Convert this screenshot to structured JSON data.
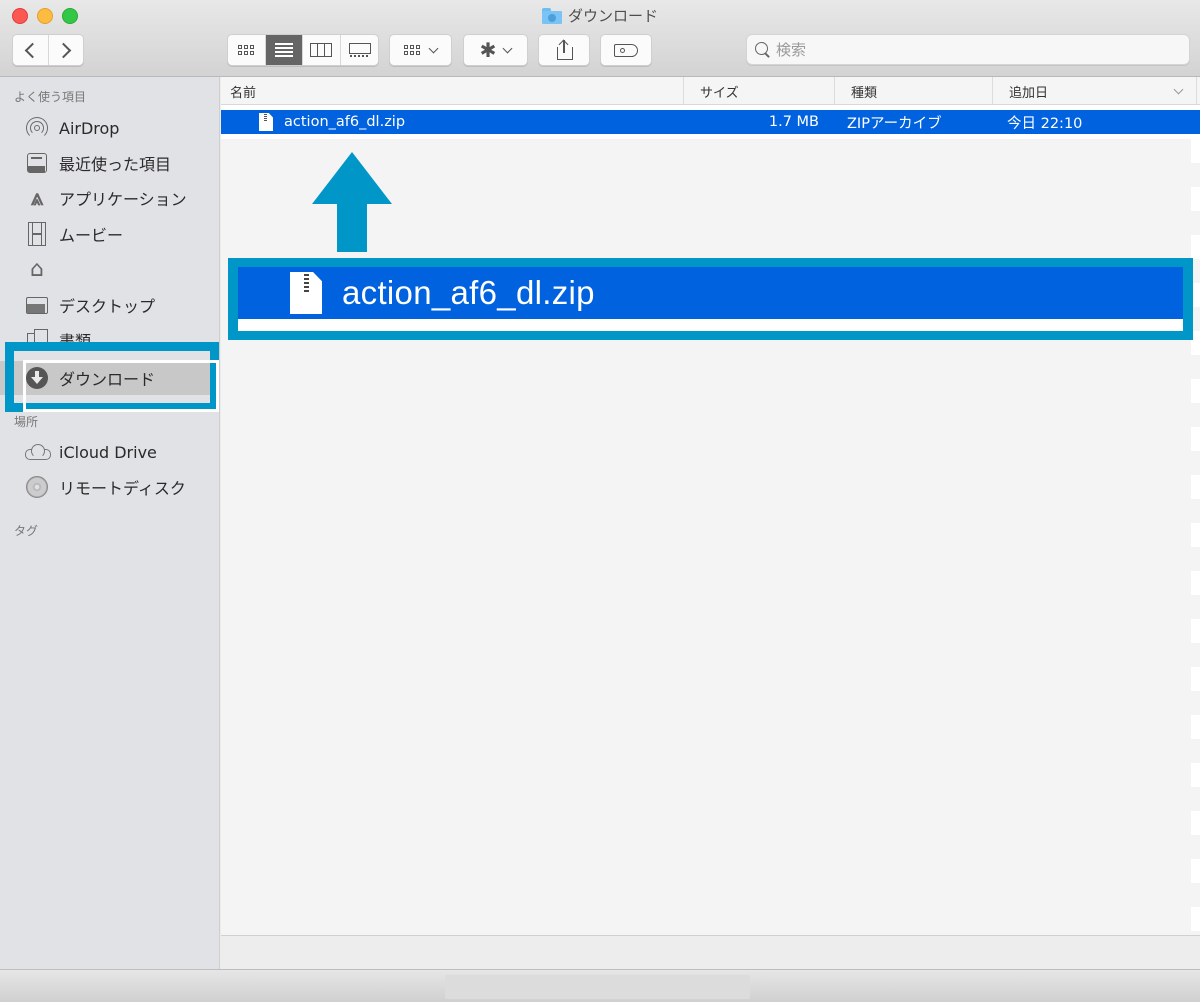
{
  "window": {
    "title": "ダウンロード",
    "title_icon": "downloads-folder-icon"
  },
  "toolbar": {
    "back_label": "戻る",
    "forward_label": "進む",
    "view_modes": [
      "icon",
      "list",
      "column",
      "gallery"
    ],
    "active_view": "list",
    "arrange_icon": "grid-icon",
    "action_icon": "gear-icon",
    "share_icon": "share-icon",
    "tag_icon": "tag-icon",
    "search_placeholder": "検索",
    "search_value": ""
  },
  "sidebar": {
    "sections": [
      {
        "heading": "よく使う項目",
        "items": [
          {
            "label": "AirDrop",
            "icon": "airdrop-icon"
          },
          {
            "label": "最近使った項目",
            "icon": "recents-icon"
          },
          {
            "label": "アプリケーション",
            "icon": "applications-icon"
          },
          {
            "label": "ムービー",
            "icon": "movies-icon"
          },
          {
            "label": "",
            "icon": "home-icon"
          },
          {
            "label": "デスクトップ",
            "icon": "desktop-icon"
          },
          {
            "label": "書類",
            "icon": "documents-icon"
          },
          {
            "label": "ダウンロード",
            "icon": "downloads-icon",
            "selected": true
          }
        ]
      },
      {
        "heading": "場所",
        "items": [
          {
            "label": "iCloud Drive",
            "icon": "icloud-icon"
          },
          {
            "label": "リモートディスク",
            "icon": "remote-disc-icon"
          }
        ]
      },
      {
        "heading": "タグ",
        "items": []
      }
    ]
  },
  "file_list": {
    "columns": [
      "名前",
      "サイズ",
      "種類",
      "追加日"
    ],
    "sort_column": "追加日",
    "rows": [
      {
        "name": "action_af6_dl.zip",
        "size": "1.7 MB",
        "kind": "ZIPアーカイブ",
        "date_added": "今日 22:10",
        "selected": true
      }
    ]
  },
  "callout": {
    "file_name": "action_af6_dl.zip",
    "arrow_direction": "up",
    "highlight_color": "#0096c7"
  },
  "colors": {
    "selection_blue": "#0062df",
    "highlight_teal": "#0096c7",
    "sidebar_bg": "#e1e2e6"
  }
}
